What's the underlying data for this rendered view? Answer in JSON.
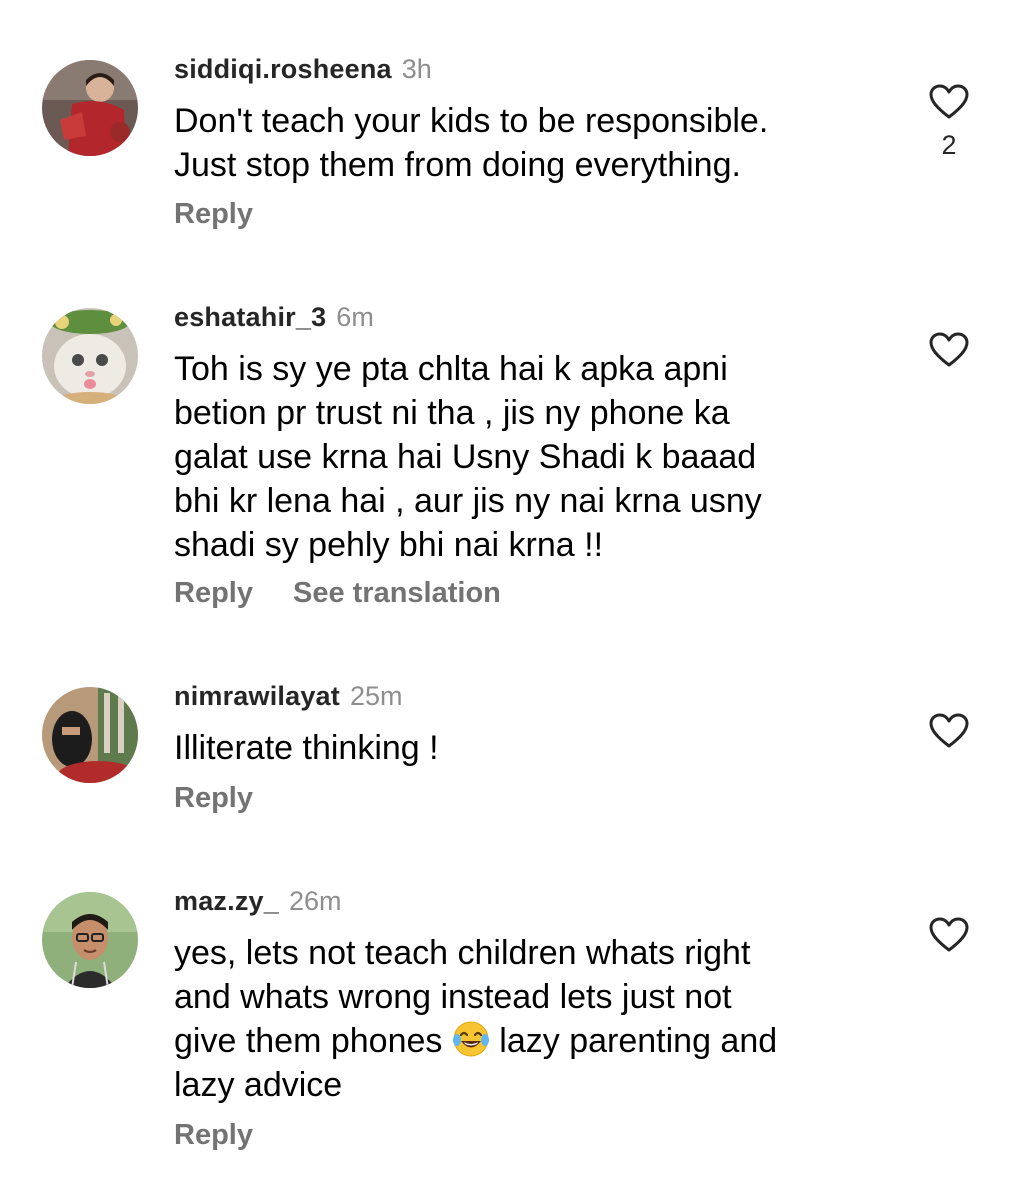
{
  "comments": [
    {
      "username": "siddiqi.rosheena",
      "time": "3h",
      "text": "Don't teach your kids to be responsible.\nJust stop them from doing everything.",
      "reply_label": "Reply",
      "like_count": "2",
      "avatar": "photo-child-red-outfit"
    },
    {
      "username": "eshatahir_3",
      "time": "6m",
      "text": "Toh is sy ye pta chlta hai k apka apni\nbetion pr trust ni tha , jis ny phone ka\ngalat use krna hai Usny Shadi k baaad\nbhi kr lena hai , aur jis ny nai krna usny\nshadi sy pehly bhi nai krna !!",
      "reply_label": "Reply",
      "translation_label": "See translation",
      "avatar": "photo-cat-with-flowers"
    },
    {
      "username": "nimrawilayat",
      "time": "25m",
      "text": "Illiterate thinking !",
      "reply_label": "Reply",
      "avatar": "photo-person-niqab"
    },
    {
      "username": "maz.zy_",
      "time": "26m",
      "text_before_emoji": "yes, lets not teach children whats right\nand whats wrong instead lets just not\ngive them phones ",
      "emoji": "face-with-tears-of-joy",
      "text_after_emoji": " lazy parenting and\nlazy advice",
      "reply_label": "Reply",
      "avatar": "photo-man-glasses-green-bg"
    }
  ],
  "icons": {
    "like": "heart-outline-icon"
  },
  "colors": {
    "username": "#262626",
    "meta": "#8e8e8e",
    "action": "#737373",
    "text": "#000000"
  }
}
